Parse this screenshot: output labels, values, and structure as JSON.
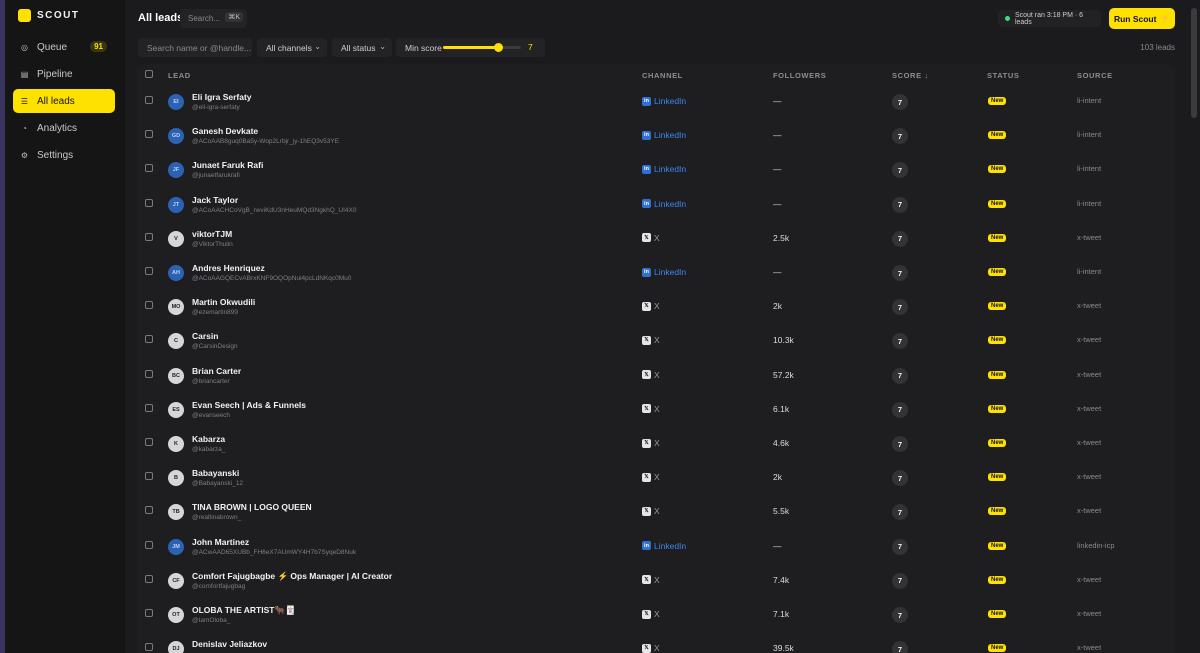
{
  "brand": {
    "name": "SCOUT"
  },
  "sidebar": {
    "items": [
      {
        "label": "Queue",
        "icon": "inbox-icon",
        "badge": "91"
      },
      {
        "label": "Pipeline",
        "icon": "board-icon"
      },
      {
        "label": "All leads",
        "icon": "list-icon",
        "active": true
      },
      {
        "label": "Analytics",
        "icon": "pie-icon"
      },
      {
        "label": "Settings",
        "icon": "gear-icon"
      }
    ]
  },
  "header": {
    "title": "All leads",
    "search_placeholder": "Search...",
    "shortcut": "⌘K",
    "status_text": "Scout ran 3:18 PM · 6 leads",
    "run_button": "Run Scout",
    "run_icon": "⚡"
  },
  "filters": {
    "search_placeholder": "Search name or @handle...",
    "channels": "All channels",
    "status": "All status",
    "min_score_label": "Min score",
    "min_score_value": "7",
    "min_score_fraction": 0.7,
    "lead_count": "103 leads"
  },
  "table": {
    "columns": {
      "lead": "LEAD",
      "channel": "CHANNEL",
      "followers": "FOLLOWERS",
      "score": "SCORE ↓",
      "status": "STATUS",
      "source": "SOURCE"
    },
    "rows": [
      {
        "initials": "EI",
        "avatar": "blue",
        "name": "Eli Igra Serfaty",
        "handle": "@eli-igra-serfaty",
        "channel": "LinkedIn",
        "ctype": "li",
        "followers": "—",
        "score": "7",
        "status": "New",
        "source": "li-intent"
      },
      {
        "initials": "GD",
        "avatar": "blue",
        "name": "Ganesh Devkate",
        "handle": "@ACoAAB8guq0Ba5y-Wop2Lrbjr_jy-1hEQ3v53YE",
        "channel": "LinkedIn",
        "ctype": "li",
        "followers": "—",
        "score": "7",
        "status": "New",
        "source": "li-intent"
      },
      {
        "initials": "JF",
        "avatar": "blue",
        "name": "Junaet Faruk Rafi",
        "handle": "@junaetfarukrafi",
        "channel": "LinkedIn",
        "ctype": "li",
        "followers": "—",
        "score": "7",
        "status": "New",
        "source": "li-intent"
      },
      {
        "initials": "JT",
        "avatar": "blue",
        "name": "Jack Taylor",
        "handle": "@ACoAACHCoVgB_rwviKdU3nHeuMQd3NgkhQ_UI4X0",
        "channel": "LinkedIn",
        "ctype": "li",
        "followers": "—",
        "score": "7",
        "status": "New",
        "source": "li-intent"
      },
      {
        "initials": "V",
        "avatar": "light",
        "name": "viktorTJM",
        "handle": "@ViktorThulin",
        "channel": "X",
        "ctype": "x",
        "followers": "2.5k",
        "score": "7",
        "status": "New",
        "source": "x-tweet"
      },
      {
        "initials": "AH",
        "avatar": "blue",
        "name": "Andres Henriquez",
        "handle": "@ACoAAGQECvABrxKNF9OQOpNul4pcLdNKqc0Mu0",
        "channel": "LinkedIn",
        "ctype": "li",
        "followers": "—",
        "score": "7",
        "status": "New",
        "source": "li-intent"
      },
      {
        "initials": "MO",
        "avatar": "light",
        "name": "Martin Okwudili",
        "handle": "@ezemartin899",
        "channel": "X",
        "ctype": "x",
        "followers": "2k",
        "score": "7",
        "status": "New",
        "source": "x-tweet"
      },
      {
        "initials": "C",
        "avatar": "light",
        "name": "Carsin",
        "handle": "@CarsinDesign",
        "channel": "X",
        "ctype": "x",
        "followers": "10.3k",
        "score": "7",
        "status": "New",
        "source": "x-tweet"
      },
      {
        "initials": "BC",
        "avatar": "light",
        "name": "Brian Carter",
        "handle": "@briancarter",
        "channel": "X",
        "ctype": "x",
        "followers": "57.2k",
        "score": "7",
        "status": "New",
        "source": "x-tweet"
      },
      {
        "initials": "ES",
        "avatar": "light",
        "name": "Evan Seech | Ads & Funnels",
        "handle": "@evanseech",
        "channel": "X",
        "ctype": "x",
        "followers": "6.1k",
        "score": "7",
        "status": "New",
        "source": "x-tweet"
      },
      {
        "initials": "K",
        "avatar": "light",
        "name": "Kabarza",
        "handle": "@kabarza_",
        "channel": "X",
        "ctype": "x",
        "followers": "4.6k",
        "score": "7",
        "status": "New",
        "source": "x-tweet"
      },
      {
        "initials": "B",
        "avatar": "light",
        "name": "Babayanski",
        "handle": "@Babayanski_12",
        "channel": "X",
        "ctype": "x",
        "followers": "2k",
        "score": "7",
        "status": "New",
        "source": "x-tweet"
      },
      {
        "initials": "TB",
        "avatar": "light",
        "name": "TINA BROWN | LOGO QUEEN",
        "handle": "@realtinabrown_",
        "channel": "X",
        "ctype": "x",
        "followers": "5.5k",
        "score": "7",
        "status": "New",
        "source": "x-tweet"
      },
      {
        "initials": "JM",
        "avatar": "blue",
        "name": "John Martinez",
        "handle": "@ACwAAD65XUBb_FH6eX7AUmWY4H7b7SyqeD8Nuk",
        "channel": "LinkedIn",
        "ctype": "li",
        "followers": "—",
        "score": "7",
        "status": "New",
        "source": "linkedin-icp"
      },
      {
        "initials": "CF",
        "avatar": "light",
        "name": "Comfort Fajugbagbe ⚡ Ops Manager | AI Creator",
        "handle": "@comfortfajugbag",
        "channel": "X",
        "ctype": "x",
        "followers": "7.4k",
        "score": "7",
        "status": "New",
        "source": "x-tweet"
      },
      {
        "initials": "OT",
        "avatar": "light",
        "name": "OLOBA THE ARTIST🐂🃏",
        "handle": "@IamOloba_",
        "channel": "X",
        "ctype": "x",
        "followers": "7.1k",
        "score": "7",
        "status": "New",
        "source": "x-tweet"
      },
      {
        "initials": "DJ",
        "avatar": "light",
        "name": "Denislav Jeliazkov",
        "handle": "",
        "channel": "X",
        "ctype": "x",
        "followers": "39.5k",
        "score": "7",
        "status": "New",
        "source": "x-tweet"
      }
    ]
  }
}
